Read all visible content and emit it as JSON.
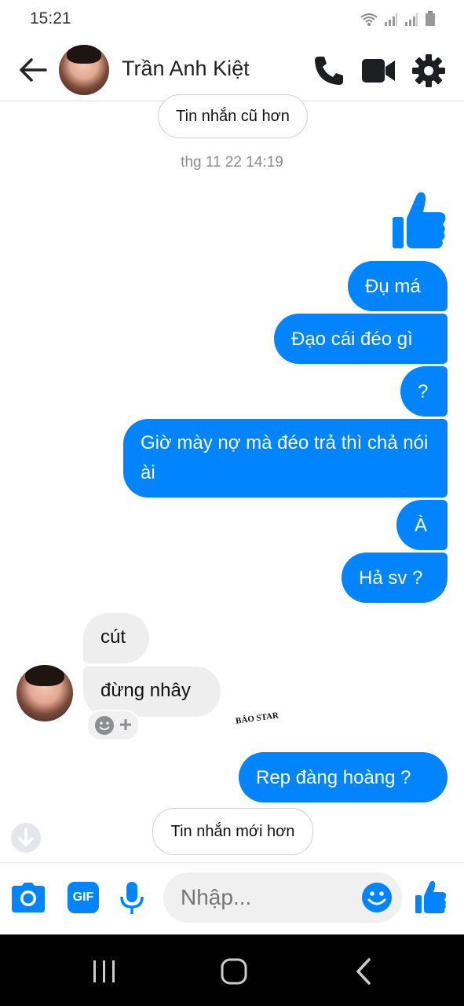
{
  "status_bar": {
    "time": "15:21"
  },
  "header": {
    "contact_name": "Trần Anh Kiệt"
  },
  "older_messages_label": "Tin nhắn cũ hơn",
  "timestamp": "thg 11 22 14:19",
  "messages_out_1": [
    "Đụ má",
    "Đạo cái đéo gì",
    "?",
    "Giờ mày nợ mà đéo trả thì chả nói ài",
    "À",
    "Hả sv ?"
  ],
  "messages_in": [
    "cút",
    "đừng nhây"
  ],
  "messages_out_2": [
    "Rep đàng hoàng ?"
  ],
  "newer_messages_label": "Tin nhắn mới hơn",
  "composer": {
    "placeholder": "Nhập...",
    "gif_label": "GIF"
  },
  "watermark": "BẢO STAR",
  "colors": {
    "accent": "#0084ff",
    "incoming_bubble": "#eeeeee"
  },
  "icons": [
    "back-arrow-icon",
    "phone-icon",
    "video-call-icon",
    "settings-gear-icon",
    "thumbs-up-icon",
    "camera-icon",
    "gif-icon",
    "microphone-icon",
    "emoji-icon",
    "add-reaction-icon",
    "scroll-down-icon"
  ]
}
